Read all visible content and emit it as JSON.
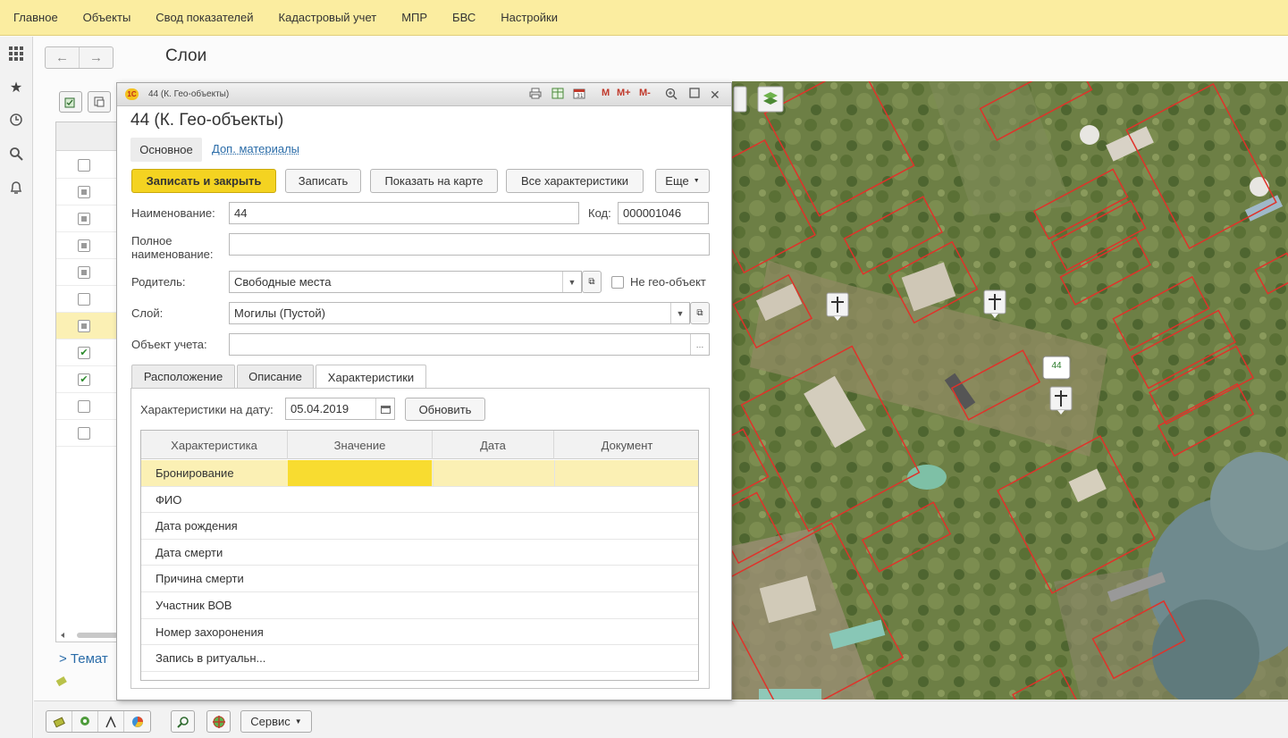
{
  "top_menu": [
    "Главное",
    "Объекты",
    "Свод показателей",
    "Кадастровый учет",
    "МПР",
    "БВС",
    "Настройки"
  ],
  "page": {
    "title": "Слои",
    "thematic_label": "> Темат"
  },
  "window": {
    "caption": "44 (К. Гео-объекты)",
    "controls": [
      "M",
      "M+",
      "M-"
    ],
    "form_title": "44 (К. Гео-объекты)",
    "tab_main": "Основное",
    "tab_additional": "Доп. материалы"
  },
  "toolbar": {
    "save_close": "Записать и закрыть",
    "save": "Записать",
    "show_on_map": "Показать на карте",
    "all_characteristics": "Все характеристики",
    "more": "Еще"
  },
  "fields": {
    "name_label": "Наименование:",
    "name_value": "44",
    "code_label": "Код:",
    "code_value": "000001046",
    "fullname_label_1": "Полное",
    "fullname_label_2": "наименование:",
    "fullname_value": "",
    "parent_label": "Родитель:",
    "parent_value": "Свободные места",
    "not_geo_label": "Не гео-объект",
    "layer_label": "Слой:",
    "layer_value": "Могилы (Пустой)",
    "account_label": "Объект учета:",
    "account_value": ""
  },
  "inner_tabs": [
    "Расположение",
    "Описание",
    "Характеристики"
  ],
  "characteristics": {
    "date_label": "Характеристики на дату:",
    "date_value": "05.04.2019",
    "refresh": "Обновить",
    "columns": [
      "Характеристика",
      "Значение",
      "Дата",
      "Документ"
    ],
    "rows": [
      "Бронирование",
      "ФИО",
      "Дата рождения",
      "Дата смерти",
      "Причина смерти",
      "Участник ВОВ",
      "Номер захоронения",
      "Запись в ритуальн..."
    ]
  },
  "map": {
    "marker_label": "44"
  },
  "bottom_toolbar": {
    "service": "Сервис"
  }
}
